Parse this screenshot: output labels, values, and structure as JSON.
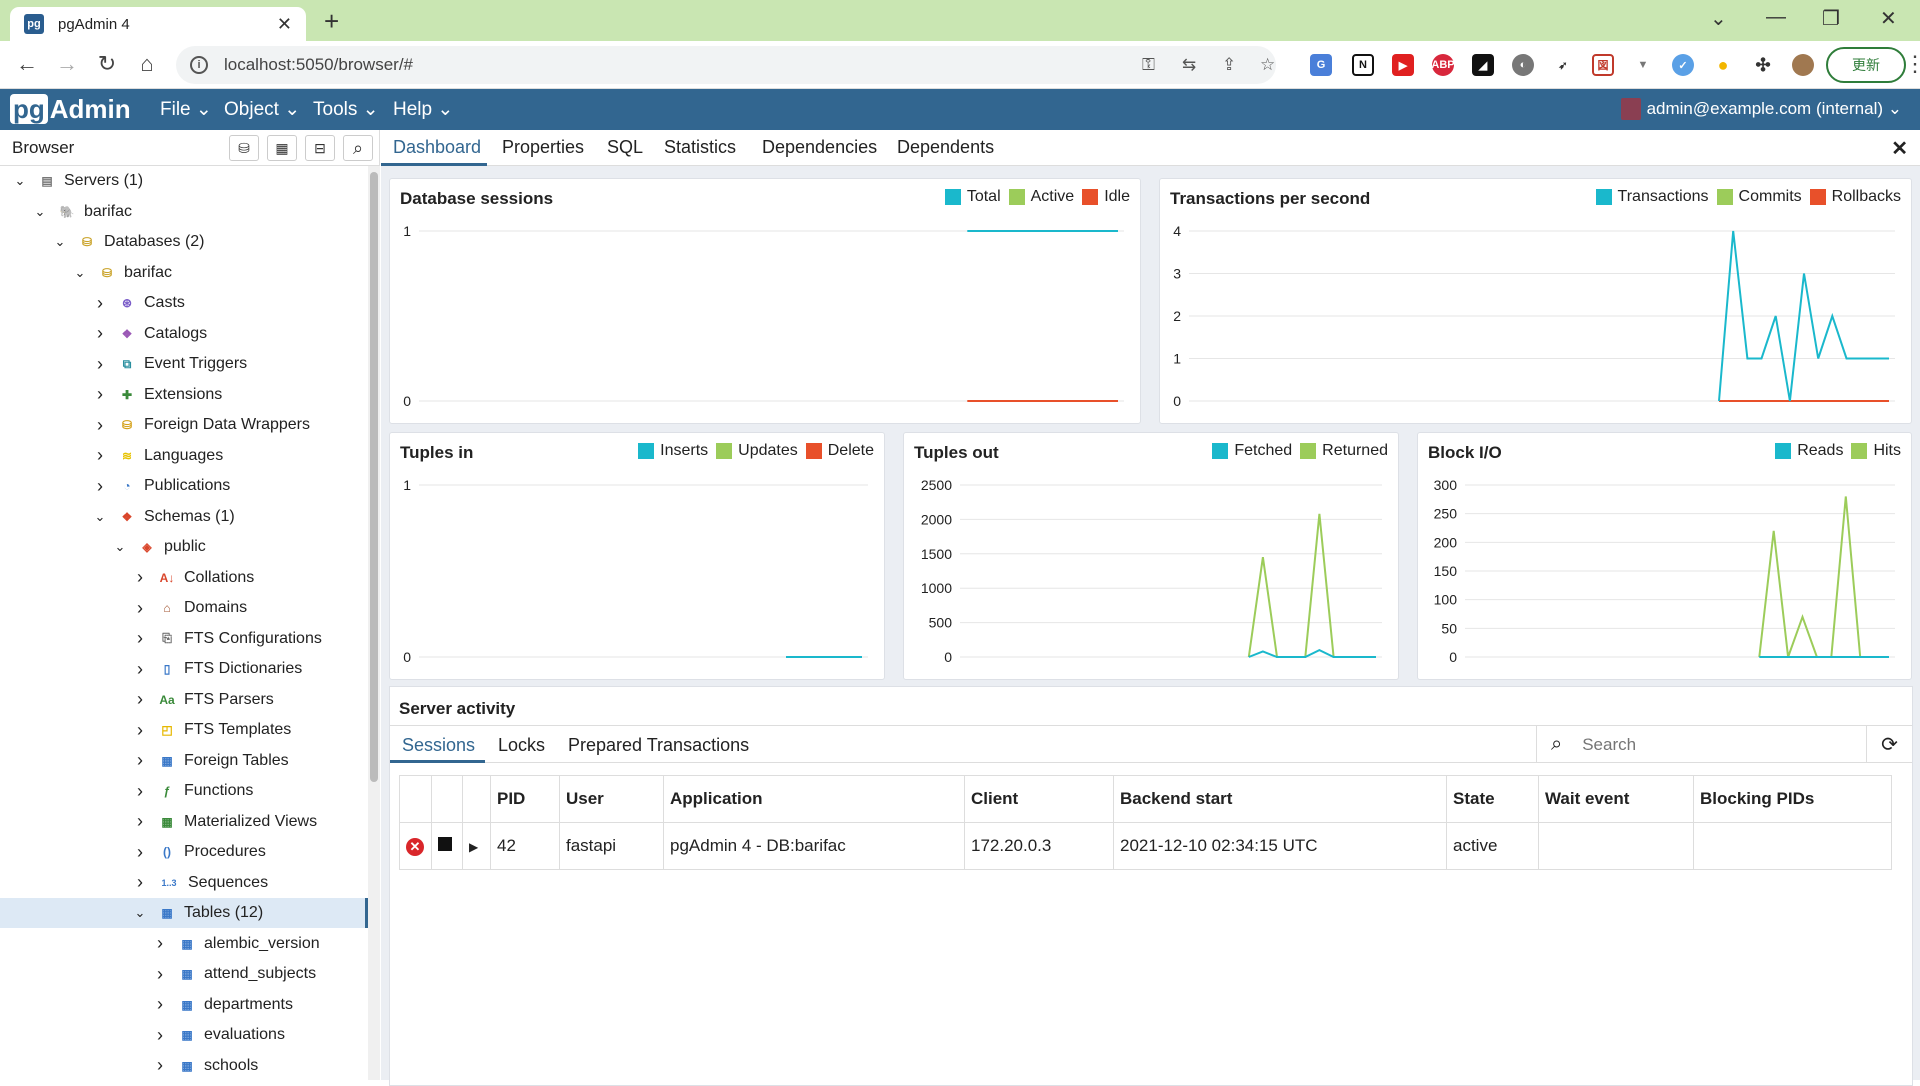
{
  "browser": {
    "tab_title": "pgAdmin 4",
    "url": "localhost:5050/browser/#",
    "update_button": "更新"
  },
  "nav": {
    "logo_pg": "pg",
    "logo_admin": "Admin",
    "menus": [
      "File",
      "Object",
      "Tools",
      "Help"
    ],
    "user": "admin@example.com (internal)"
  },
  "browser_panel": {
    "title": "Browser",
    "tree": [
      {
        "label": "Servers (1)",
        "depth": 0,
        "expanded": true,
        "icon": "servers-icon"
      },
      {
        "label": "barifac",
        "depth": 1,
        "expanded": true,
        "icon": "postgres-server-icon"
      },
      {
        "label": "Databases (2)",
        "depth": 2,
        "expanded": true,
        "icon": "databases-icon"
      },
      {
        "label": "barifac",
        "depth": 3,
        "expanded": true,
        "icon": "database-icon"
      },
      {
        "label": "Casts",
        "depth": 4,
        "expanded": false,
        "icon": "casts-icon"
      },
      {
        "label": "Catalogs",
        "depth": 4,
        "expanded": false,
        "icon": "catalogs-icon"
      },
      {
        "label": "Event Triggers",
        "depth": 4,
        "expanded": false,
        "icon": "event-triggers-icon"
      },
      {
        "label": "Extensions",
        "depth": 4,
        "expanded": false,
        "icon": "extensions-icon"
      },
      {
        "label": "Foreign Data Wrappers",
        "depth": 4,
        "expanded": false,
        "icon": "fdw-icon"
      },
      {
        "label": "Languages",
        "depth": 4,
        "expanded": false,
        "icon": "languages-icon"
      },
      {
        "label": "Publications",
        "depth": 4,
        "expanded": false,
        "icon": "publications-icon"
      },
      {
        "label": "Schemas (1)",
        "depth": 4,
        "expanded": true,
        "icon": "schemas-icon"
      },
      {
        "label": "public",
        "depth": 5,
        "expanded": true,
        "icon": "schema-icon"
      },
      {
        "label": "Collations",
        "depth": 6,
        "expanded": false,
        "icon": "collations-icon"
      },
      {
        "label": "Domains",
        "depth": 6,
        "expanded": false,
        "icon": "domains-icon"
      },
      {
        "label": "FTS Configurations",
        "depth": 6,
        "expanded": false,
        "icon": "fts-config-icon"
      },
      {
        "label": "FTS Dictionaries",
        "depth": 6,
        "expanded": false,
        "icon": "fts-dict-icon"
      },
      {
        "label": "FTS Parsers",
        "depth": 6,
        "expanded": false,
        "icon": "fts-parsers-icon"
      },
      {
        "label": "FTS Templates",
        "depth": 6,
        "expanded": false,
        "icon": "fts-templates-icon"
      },
      {
        "label": "Foreign Tables",
        "depth": 6,
        "expanded": false,
        "icon": "foreign-tables-icon"
      },
      {
        "label": "Functions",
        "depth": 6,
        "expanded": false,
        "icon": "functions-icon"
      },
      {
        "label": "Materialized Views",
        "depth": 6,
        "expanded": false,
        "icon": "mviews-icon"
      },
      {
        "label": "Procedures",
        "depth": 6,
        "expanded": false,
        "icon": "procedures-icon"
      },
      {
        "label": "Sequences",
        "depth": 6,
        "expanded": false,
        "icon": "sequences-icon"
      },
      {
        "label": "Tables (12)",
        "depth": 6,
        "expanded": true,
        "icon": "tables-icon",
        "selected": true
      },
      {
        "label": "alembic_version",
        "depth": 7,
        "expanded": false,
        "icon": "table-icon"
      },
      {
        "label": "attend_subjects",
        "depth": 7,
        "expanded": false,
        "icon": "table-icon"
      },
      {
        "label": "departments",
        "depth": 7,
        "expanded": false,
        "icon": "table-icon"
      },
      {
        "label": "evaluations",
        "depth": 7,
        "expanded": false,
        "icon": "table-icon"
      },
      {
        "label": "schools",
        "depth": 7,
        "expanded": false,
        "icon": "table-icon"
      }
    ]
  },
  "main_tabs": [
    "Dashboard",
    "Properties",
    "SQL",
    "Statistics",
    "Dependencies",
    "Dependents"
  ],
  "colors": {
    "blue": "#1ab8cc",
    "green": "#9ccc5a",
    "red": "#e8502a",
    "accent": "#326690"
  },
  "chart_data": [
    {
      "type": "line",
      "title": "Database sessions",
      "yticks": [
        0,
        1
      ],
      "ylim": [
        0,
        1
      ],
      "series": [
        {
          "name": "Total",
          "color": "#1ab8cc",
          "values": [
            null,
            null,
            null,
            null,
            null,
            null,
            null,
            null,
            null,
            null,
            null,
            null,
            null,
            null,
            null,
            null,
            null,
            null,
            1,
            1,
            1,
            1,
            1,
            1
          ]
        },
        {
          "name": "Active",
          "color": "#9ccc5a",
          "values": []
        },
        {
          "name": "Idle",
          "color": "#e8502a",
          "values": [
            null,
            null,
            null,
            null,
            null,
            null,
            null,
            null,
            null,
            null,
            null,
            null,
            null,
            null,
            null,
            null,
            null,
            null,
            0,
            0,
            0,
            0,
            0,
            0
          ]
        }
      ],
      "points": 24
    },
    {
      "type": "line",
      "title": "Transactions per second",
      "yticks": [
        0,
        1,
        2,
        3,
        4
      ],
      "ylim": [
        0,
        4
      ],
      "series": [
        {
          "name": "Transactions",
          "color": "#1ab8cc",
          "values": [
            null,
            null,
            null,
            null,
            null,
            null,
            null,
            null,
            null,
            null,
            null,
            null,
            null,
            null,
            null,
            null,
            null,
            null,
            null,
            null,
            null,
            null,
            null,
            null,
            null,
            null,
            null,
            null,
            null,
            null,
            null,
            null,
            null,
            null,
            null,
            null,
            null,
            0,
            4,
            1,
            1,
            2,
            0,
            3,
            1,
            2,
            1,
            1,
            1,
            1
          ]
        },
        {
          "name": "Commits",
          "color": "#9ccc5a",
          "values": []
        },
        {
          "name": "Rollbacks",
          "color": "#e8502a",
          "values": [
            null,
            null,
            null,
            null,
            null,
            null,
            null,
            null,
            null,
            null,
            null,
            null,
            null,
            null,
            null,
            null,
            null,
            null,
            null,
            null,
            null,
            null,
            null,
            null,
            null,
            null,
            null,
            null,
            null,
            null,
            null,
            null,
            null,
            null,
            null,
            null,
            null,
            0,
            0,
            0,
            0,
            0,
            0,
            0,
            0,
            0,
            0,
            0,
            0,
            0
          ]
        }
      ],
      "points": 50
    },
    {
      "type": "line",
      "title": "Tuples in",
      "yticks": [
        0,
        1
      ],
      "ylim": [
        0,
        1
      ],
      "series": [
        {
          "name": "Inserts",
          "color": "#1ab8cc",
          "values": [
            null,
            null,
            null,
            null,
            null,
            null,
            null,
            null,
            null,
            null,
            null,
            null,
            null,
            null,
            null,
            null,
            null,
            null,
            null,
            0,
            0,
            0,
            0,
            0
          ]
        },
        {
          "name": "Updates",
          "color": "#9ccc5a",
          "values": []
        },
        {
          "name": "Delete",
          "color": "#e8502a",
          "values": []
        }
      ],
      "points": 24
    },
    {
      "type": "line",
      "title": "Tuples out",
      "yticks": [
        0,
        500,
        1000,
        1500,
        2000,
        2500
      ],
      "ylim": [
        0,
        2500
      ],
      "series": [
        {
          "name": "Fetched",
          "color": "#1ab8cc",
          "values": [
            null,
            null,
            null,
            null,
            null,
            null,
            null,
            null,
            null,
            null,
            null,
            null,
            null,
            null,
            null,
            null,
            null,
            null,
            null,
            null,
            0,
            80,
            0,
            0,
            0,
            100,
            0,
            0,
            0,
            0
          ]
        },
        {
          "name": "Returned",
          "color": "#9ccc5a",
          "values": [
            null,
            null,
            null,
            null,
            null,
            null,
            null,
            null,
            null,
            null,
            null,
            null,
            null,
            null,
            null,
            null,
            null,
            null,
            null,
            null,
            0,
            1450,
            0,
            0,
            0,
            2080,
            0,
            0,
            0,
            0
          ]
        }
      ],
      "points": 30
    },
    {
      "type": "line",
      "title": "Block I/O",
      "yticks": [
        0,
        50,
        100,
        150,
        200,
        250,
        300
      ],
      "ylim": [
        0,
        300
      ],
      "series": [
        {
          "name": "Reads",
          "color": "#1ab8cc",
          "values": [
            null,
            null,
            null,
            null,
            null,
            null,
            null,
            null,
            null,
            null,
            null,
            null,
            null,
            null,
            null,
            null,
            null,
            null,
            null,
            null,
            0,
            0,
            0,
            0,
            0,
            0,
            0,
            0,
            0,
            0
          ]
        },
        {
          "name": "Hits",
          "color": "#9ccc5a",
          "values": [
            null,
            null,
            null,
            null,
            null,
            null,
            null,
            null,
            null,
            null,
            null,
            null,
            null,
            null,
            null,
            null,
            null,
            null,
            null,
            null,
            0,
            220,
            0,
            70,
            0,
            0,
            280,
            0,
            0,
            0
          ]
        }
      ],
      "points": 30
    }
  ],
  "server_activity": {
    "title": "Server activity",
    "tabs": [
      "Sessions",
      "Locks",
      "Prepared Transactions"
    ],
    "search_placeholder": "Search",
    "columns": [
      "PID",
      "User",
      "Application",
      "Client",
      "Backend start",
      "State",
      "Wait event",
      "Blocking PIDs"
    ],
    "rows": [
      [
        "42",
        "fastapi",
        "pgAdmin 4 - DB:barifac",
        "172.20.0.3",
        "2021-12-10 02:34:15 UTC",
        "active",
        "",
        ""
      ]
    ]
  }
}
